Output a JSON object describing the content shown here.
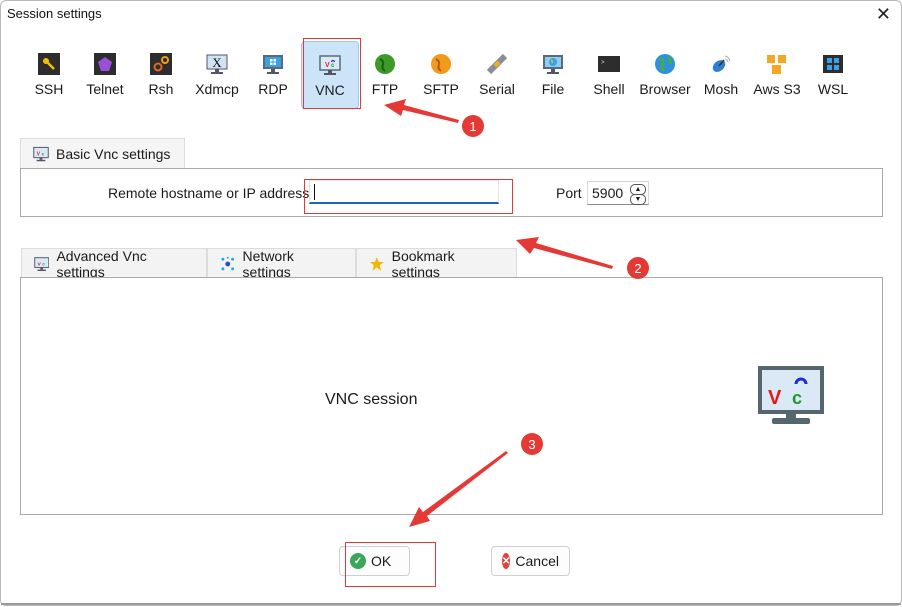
{
  "window": {
    "title": "Session settings",
    "close_icon": "close-icon"
  },
  "protocols": [
    {
      "label": "SSH",
      "icon": "key-icon"
    },
    {
      "label": "Telnet",
      "icon": "purple-gem-icon"
    },
    {
      "label": "Rsh",
      "icon": "gears-icon"
    },
    {
      "label": "Xdmcp",
      "icon": "x-monitor-icon"
    },
    {
      "label": "RDP",
      "icon": "windows-monitor-icon"
    },
    {
      "label": "VNC",
      "icon": "vnc-monitor-icon",
      "active": true
    },
    {
      "label": "FTP",
      "icon": "green-globe-icon"
    },
    {
      "label": "SFTP",
      "icon": "orange-globe-icon"
    },
    {
      "label": "Serial",
      "icon": "plug-icon"
    },
    {
      "label": "File",
      "icon": "globe-monitor-icon"
    },
    {
      "label": "Shell",
      "icon": "terminal-icon"
    },
    {
      "label": "Browser",
      "icon": "earth-icon"
    },
    {
      "label": "Mosh",
      "icon": "satellite-dish-icon"
    },
    {
      "label": "Aws S3",
      "icon": "cubes-icon"
    },
    {
      "label": "WSL",
      "icon": "windows-logo-icon"
    }
  ],
  "basic_tab": {
    "label": "Basic Vnc settings"
  },
  "basic": {
    "host_label": "Remote hostname or IP address *",
    "host_value": "",
    "port_label": "Port",
    "port_value": "5900"
  },
  "advanced_tabs": [
    {
      "label": "Advanced Vnc settings",
      "icon": "vnc-monitor-icon"
    },
    {
      "label": "Network settings",
      "icon": "network-icon"
    },
    {
      "label": "Bookmark settings",
      "icon": "star-icon"
    }
  ],
  "session_label": "VNC session",
  "buttons": {
    "ok": "OK",
    "cancel": "Cancel"
  },
  "annotations": [
    "1",
    "2",
    "3"
  ],
  "colors": {
    "accent": "#1a64c0",
    "active_bg": "#cce4f7",
    "annotation_red": "#e53935",
    "ok_green": "#3aa657",
    "cancel_red": "#e0433a"
  }
}
